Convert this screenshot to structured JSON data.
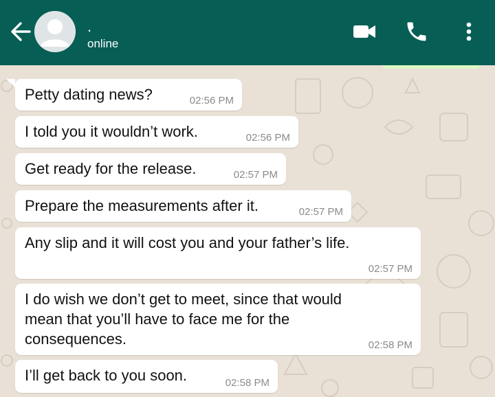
{
  "header": {
    "contact_name": ".",
    "status": "online",
    "colors": {
      "bar": "#075e54",
      "icons": "#ffffff"
    },
    "icons": [
      "back-arrow-icon",
      "avatar-icon",
      "video-call-icon",
      "phone-call-icon",
      "more-options-icon"
    ]
  },
  "messages": [
    {
      "text": "Petty dating news?",
      "time": "02:56 PM"
    },
    {
      "text": "I told you it wouldn’t work.",
      "time": "02:56 PM"
    },
    {
      "text": "Get ready for the release.",
      "time": "02:57 PM"
    },
    {
      "text": "Prepare the measurements after it.",
      "time": "02:57 PM"
    },
    {
      "text": "Any slip and it will cost you and your father’s life.",
      "time": "02:57 PM"
    },
    {
      "text": "I do wish we don’t get to meet, since that would mean that you’ll have to face me for the consequences.",
      "time": "02:58 PM"
    },
    {
      "text": "I’ll get back to you soon.",
      "time": "02:58 PM"
    }
  ],
  "theme": {
    "wallpaper": "#e9e1d6",
    "incoming_bubble": "#ffffff",
    "outgoing_bubble": "#dcf8c6"
  }
}
